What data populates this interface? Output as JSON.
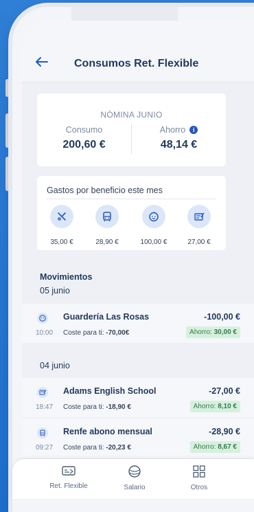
{
  "header": {
    "title": "Consumos Ret. Flexible",
    "back_icon": "arrow-left-icon"
  },
  "nomina": {
    "title": "NÓMINA JUNIO",
    "consumo_label": "Consumo",
    "consumo_value": "200,60 €",
    "ahorro_label": "Ahorro",
    "ahorro_value": "48,14 €",
    "info_icon": "info-icon"
  },
  "gastos": {
    "title": "Gastos por beneficio este mes",
    "items": [
      {
        "icon": "restaurant-icon",
        "value": "35,00 €"
      },
      {
        "icon": "bus-icon",
        "value": "28,90 €"
      },
      {
        "icon": "baby-icon",
        "value": "100,00 €"
      },
      {
        "icon": "education-icon",
        "value": "27,00 €"
      }
    ]
  },
  "movimientos": {
    "title": "Movimientos",
    "groups": [
      {
        "date": "05 junio",
        "items": [
          {
            "icon": "baby-icon",
            "name": "Guardería Las Rosas",
            "amount": "-100,00 €",
            "time": "10:00",
            "cost_label": "Coste para ti: ",
            "cost_value": "-70,00€",
            "ahorro_label": "Ahorro: ",
            "ahorro_value": "30,00 €"
          }
        ]
      },
      {
        "date": "04 junio",
        "items": [
          {
            "icon": "education-icon",
            "name": "Adams English School",
            "amount": "-27,00 €",
            "time": "18:47",
            "cost_label": "Coste para ti: ",
            "cost_value": "-18,90 €",
            "ahorro_label": "Ahorro: ",
            "ahorro_value": "8,10 €"
          },
          {
            "icon": "bus-icon",
            "name": "Renfe abono mensual",
            "amount": "-28,90 €",
            "time": "09:27",
            "cost_label": "Coste para ti: ",
            "cost_value": "-20,23 €",
            "ahorro_label": "Ahorro: ",
            "ahorro_value": "8,67 €"
          }
        ]
      }
    ]
  },
  "bottom_nav": [
    {
      "label": "Ret. Flexible",
      "icon": "card-icon"
    },
    {
      "label": "Salario",
      "icon": "salary-icon"
    },
    {
      "label": "Otros",
      "icon": "grid-icon"
    }
  ],
  "colors": {
    "accent": "#1f5bb8",
    "background": "#2f7fd6",
    "savings": "#2f7d47"
  }
}
